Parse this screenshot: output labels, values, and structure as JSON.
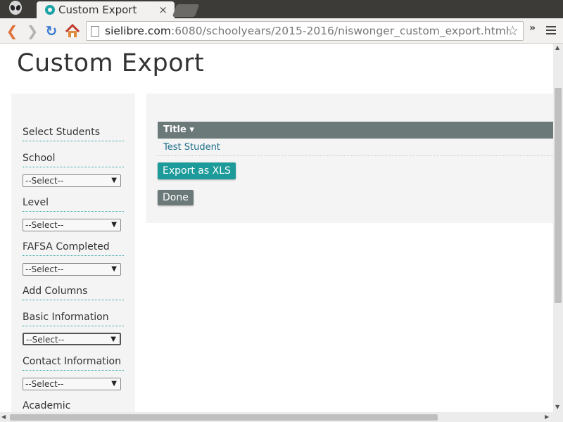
{
  "browser": {
    "tab_title": "Custom Export",
    "tab_close": "×",
    "url_host": "sielibre.com",
    "url_path": ":6080/schoolyears/2015-2016/niswonger_custom_export.html",
    "extensions_label": "»"
  },
  "page": {
    "title": "Custom Export"
  },
  "sidebar": {
    "select_students": "Select Students",
    "school_label": "School",
    "school_value": "--Select--",
    "level_label": "Level",
    "level_value": "--Select--",
    "fafsa_label": "FAFSA Completed",
    "fafsa_value": "--Select--",
    "add_columns": "Add Columns",
    "basic_label": "Basic Information",
    "basic_value": "--Select--",
    "contact_label": "Contact Information",
    "contact_value": "--Select--",
    "academic_label": "Academic"
  },
  "table": {
    "header": "Title ▾",
    "rows": [
      "Test Student"
    ]
  },
  "buttons": {
    "export_xls": "Export as XLS",
    "done": "Done"
  },
  "colors": {
    "accent": "#1d9a9a",
    "header_bg": "#6b7978",
    "panel_bg": "#f4f4f4"
  }
}
